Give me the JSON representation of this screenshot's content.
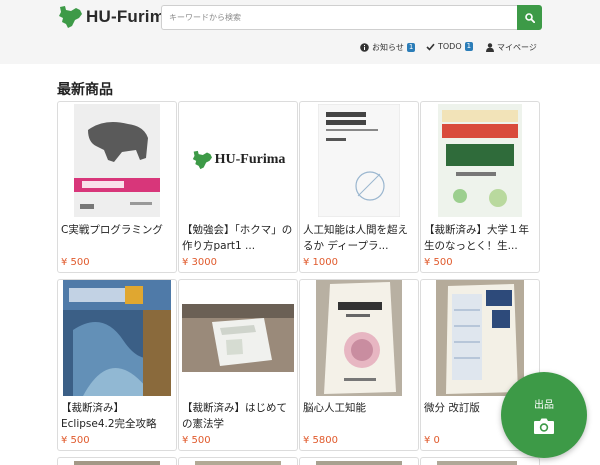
{
  "header": {
    "logo_text": "HU-Furima",
    "search_placeholder": "キーワードから検索",
    "nav": {
      "notice_label": "お知らせ",
      "notice_count": "1",
      "todo_label": "TODO",
      "todo_count": "1",
      "mypage_label": "マイページ"
    }
  },
  "section": {
    "title": "最新商品"
  },
  "products": [
    {
      "title": "C実戦プログラミング",
      "price": "¥ 500"
    },
    {
      "title": "【勉強会】「ホクマ」の作り方part1 ...",
      "price": "¥ 3000",
      "thumb_text": "HU-Furima"
    },
    {
      "title": "人工知能は人間を超えるか ディープラ...",
      "price": "¥ 1000"
    },
    {
      "title": "【裁断済み】大学１年生のなっとく！生...",
      "price": "¥ 500"
    },
    {
      "title": "【裁断済み】Eclipse4.2完全攻略",
      "price": "¥ 500"
    },
    {
      "title": "【裁断済み】はじめての憲法学",
      "price": "¥ 500"
    },
    {
      "title": "脳心人工知能",
      "price": "¥ 5800"
    },
    {
      "title": "微分 改訂版",
      "price": "¥ 0"
    }
  ],
  "fab": {
    "label": "出品"
  },
  "colors": {
    "brand_green": "#3d9a47",
    "price_orange": "#e05a2c",
    "badge_blue": "#2b7db8"
  }
}
